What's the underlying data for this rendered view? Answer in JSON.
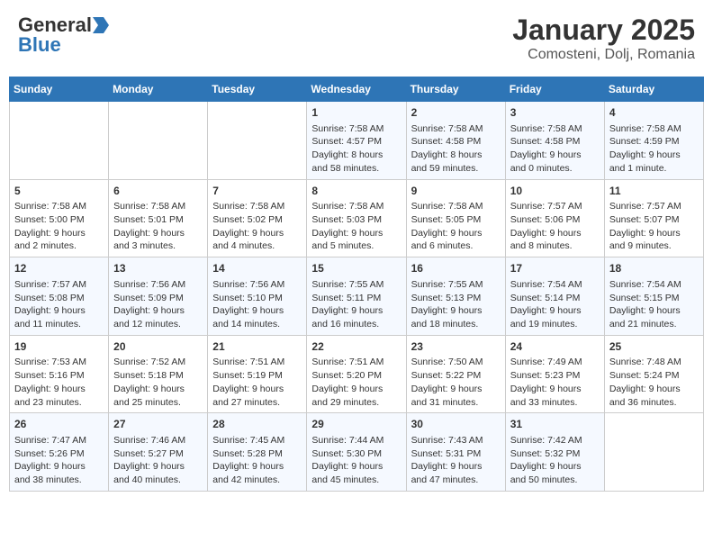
{
  "header": {
    "logo_general": "General",
    "logo_blue": "Blue",
    "title": "January 2025",
    "subtitle": "Comosteni, Dolj, Romania"
  },
  "calendar": {
    "days_of_week": [
      "Sunday",
      "Monday",
      "Tuesday",
      "Wednesday",
      "Thursday",
      "Friday",
      "Saturday"
    ],
    "weeks": [
      [
        {
          "day": "",
          "content": ""
        },
        {
          "day": "",
          "content": ""
        },
        {
          "day": "",
          "content": ""
        },
        {
          "day": "1",
          "content": "Sunrise: 7:58 AM\nSunset: 4:57 PM\nDaylight: 8 hours\nand 58 minutes."
        },
        {
          "day": "2",
          "content": "Sunrise: 7:58 AM\nSunset: 4:58 PM\nDaylight: 8 hours\nand 59 minutes."
        },
        {
          "day": "3",
          "content": "Sunrise: 7:58 AM\nSunset: 4:58 PM\nDaylight: 9 hours\nand 0 minutes."
        },
        {
          "day": "4",
          "content": "Sunrise: 7:58 AM\nSunset: 4:59 PM\nDaylight: 9 hours\nand 1 minute."
        }
      ],
      [
        {
          "day": "5",
          "content": "Sunrise: 7:58 AM\nSunset: 5:00 PM\nDaylight: 9 hours\nand 2 minutes."
        },
        {
          "day": "6",
          "content": "Sunrise: 7:58 AM\nSunset: 5:01 PM\nDaylight: 9 hours\nand 3 minutes."
        },
        {
          "day": "7",
          "content": "Sunrise: 7:58 AM\nSunset: 5:02 PM\nDaylight: 9 hours\nand 4 minutes."
        },
        {
          "day": "8",
          "content": "Sunrise: 7:58 AM\nSunset: 5:03 PM\nDaylight: 9 hours\nand 5 minutes."
        },
        {
          "day": "9",
          "content": "Sunrise: 7:58 AM\nSunset: 5:05 PM\nDaylight: 9 hours\nand 6 minutes."
        },
        {
          "day": "10",
          "content": "Sunrise: 7:57 AM\nSunset: 5:06 PM\nDaylight: 9 hours\nand 8 minutes."
        },
        {
          "day": "11",
          "content": "Sunrise: 7:57 AM\nSunset: 5:07 PM\nDaylight: 9 hours\nand 9 minutes."
        }
      ],
      [
        {
          "day": "12",
          "content": "Sunrise: 7:57 AM\nSunset: 5:08 PM\nDaylight: 9 hours\nand 11 minutes."
        },
        {
          "day": "13",
          "content": "Sunrise: 7:56 AM\nSunset: 5:09 PM\nDaylight: 9 hours\nand 12 minutes."
        },
        {
          "day": "14",
          "content": "Sunrise: 7:56 AM\nSunset: 5:10 PM\nDaylight: 9 hours\nand 14 minutes."
        },
        {
          "day": "15",
          "content": "Sunrise: 7:55 AM\nSunset: 5:11 PM\nDaylight: 9 hours\nand 16 minutes."
        },
        {
          "day": "16",
          "content": "Sunrise: 7:55 AM\nSunset: 5:13 PM\nDaylight: 9 hours\nand 18 minutes."
        },
        {
          "day": "17",
          "content": "Sunrise: 7:54 AM\nSunset: 5:14 PM\nDaylight: 9 hours\nand 19 minutes."
        },
        {
          "day": "18",
          "content": "Sunrise: 7:54 AM\nSunset: 5:15 PM\nDaylight: 9 hours\nand 21 minutes."
        }
      ],
      [
        {
          "day": "19",
          "content": "Sunrise: 7:53 AM\nSunset: 5:16 PM\nDaylight: 9 hours\nand 23 minutes."
        },
        {
          "day": "20",
          "content": "Sunrise: 7:52 AM\nSunset: 5:18 PM\nDaylight: 9 hours\nand 25 minutes."
        },
        {
          "day": "21",
          "content": "Sunrise: 7:51 AM\nSunset: 5:19 PM\nDaylight: 9 hours\nand 27 minutes."
        },
        {
          "day": "22",
          "content": "Sunrise: 7:51 AM\nSunset: 5:20 PM\nDaylight: 9 hours\nand 29 minutes."
        },
        {
          "day": "23",
          "content": "Sunrise: 7:50 AM\nSunset: 5:22 PM\nDaylight: 9 hours\nand 31 minutes."
        },
        {
          "day": "24",
          "content": "Sunrise: 7:49 AM\nSunset: 5:23 PM\nDaylight: 9 hours\nand 33 minutes."
        },
        {
          "day": "25",
          "content": "Sunrise: 7:48 AM\nSunset: 5:24 PM\nDaylight: 9 hours\nand 36 minutes."
        }
      ],
      [
        {
          "day": "26",
          "content": "Sunrise: 7:47 AM\nSunset: 5:26 PM\nDaylight: 9 hours\nand 38 minutes."
        },
        {
          "day": "27",
          "content": "Sunrise: 7:46 AM\nSunset: 5:27 PM\nDaylight: 9 hours\nand 40 minutes."
        },
        {
          "day": "28",
          "content": "Sunrise: 7:45 AM\nSunset: 5:28 PM\nDaylight: 9 hours\nand 42 minutes."
        },
        {
          "day": "29",
          "content": "Sunrise: 7:44 AM\nSunset: 5:30 PM\nDaylight: 9 hours\nand 45 minutes."
        },
        {
          "day": "30",
          "content": "Sunrise: 7:43 AM\nSunset: 5:31 PM\nDaylight: 9 hours\nand 47 minutes."
        },
        {
          "day": "31",
          "content": "Sunrise: 7:42 AM\nSunset: 5:32 PM\nDaylight: 9 hours\nand 50 minutes."
        },
        {
          "day": "",
          "content": ""
        }
      ]
    ]
  }
}
